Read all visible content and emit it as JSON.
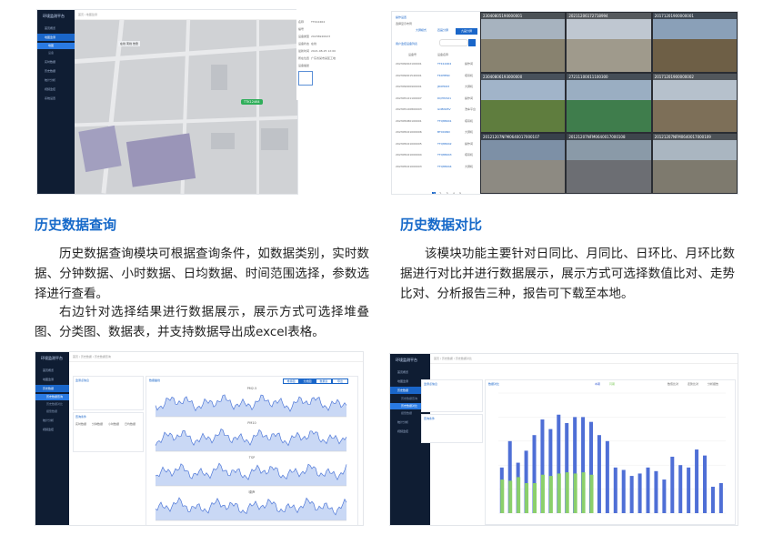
{
  "sections": {
    "history_query": {
      "title": "历史数据查询",
      "paragraph1": "历史数据查询模块可根据查询条件，如数据类别，实时数据、分钟数据、小时数据、日均数据、时间范围选择，参数选择进行查看。",
      "paragraph2": "右边针对选择结果进行数据展示，展示方式可选择堆叠图、分类图、数据表，并支持数据导出成excel表格。"
    },
    "history_compare": {
      "title": "历史数据对比",
      "paragraph1": "该模块功能主要针对日同比、月同比、日环比、月环比数据进行对比并进行数据展示，展示方式可选择数值比对、走势比对、分析报告三种，报告可下载至本地。"
    }
  },
  "shot_map": {
    "sidebar_title": "环境监测平台",
    "marker_label": "TTK12464",
    "info_rows": [
      "名称",
      "编号",
      "设备类型",
      "设备状态",
      "最新时间",
      "所在位置",
      "设备描述"
    ],
    "info_values": [
      "TTK12464",
      "",
      "20236920023",
      "在线",
      "2021-08-25 12:00",
      "广东省某市某区工地",
      ""
    ],
    "legend": [
      "在线",
      "离线",
      "告警"
    ]
  },
  "shot_video": {
    "panel_title": "操作设置",
    "tabs": [
      "大屏模式",
      "四画分屏",
      "九画分屏"
    ],
    "list_title": "用户监控设备列表",
    "col_headers": [
      "设备号",
      "设备名称"
    ],
    "rows": [
      [
        "202309002100001",
        "TTK12464",
        "操作间"
      ],
      [
        "202309001540001",
        "FK0HE60",
        "塔吊机"
      ],
      [
        "202309000900001",
        "JD0HK63",
        "大屏机"
      ],
      [
        "202305121100007",
        "DQHS5O1",
        "操作间"
      ],
      [
        "202305120800003",
        "GCBN45V",
        "洗车平台"
      ],
      [
        "202305080100001",
        "TTQ88941",
        "塔吊机"
      ],
      [
        "202305021000006",
        "BT0006D",
        "大屏机"
      ],
      [
        "202305021000005",
        "TTQ88942",
        "操作间"
      ],
      [
        "202305021000004",
        "TTQ88943",
        "塔吊机"
      ],
      [
        "202305021000003",
        "TTQ88944",
        "大屏机"
      ]
    ],
    "pagination": [
      "1",
      "2",
      "3",
      "4",
      "5",
      "..."
    ],
    "cameras": [
      "23040805190000001",
      "20211206172718994",
      "20171201900000001",
      "23040806193000000",
      "27211100011100300",
      "20171201900000002",
      "20121207NFM0640017000107",
      "20121207NFM0640017000108",
      "20121207NFM0640017000109"
    ]
  },
  "shot_query": {
    "sidebar_title": "环境监测平台",
    "info_title": "监测点信息",
    "query_title": "查询条件",
    "chart_title": "数据曲线",
    "data_types": [
      "实时数据",
      "分钟数据",
      "小时数据",
      "日均数据"
    ],
    "buttons": [
      "堆叠图",
      "分类图",
      "数据表",
      "导出"
    ],
    "series_labels": [
      "PM2.5",
      "PM10",
      "TSP",
      "噪声"
    ]
  },
  "shot_compare": {
    "info_title": "监测点信息",
    "query_title": "查询条件",
    "chart_title": "数据对比",
    "legend": [
      "本期",
      "同期"
    ],
    "modes": [
      "数值比对",
      "走势比对",
      "分析报告"
    ],
    "chart_data": {
      "type": "bar",
      "series": [
        {
          "name": "本期",
          "color": "#4f6fd6",
          "values": [
            0.38,
            0.6,
            0.42,
            0.52,
            0.65,
            0.78,
            0.7,
            0.82,
            0.75,
            0.8,
            0.8,
            0.76,
            0.65,
            0.6,
            0.38,
            0.36,
            0.31,
            0.33,
            0.38,
            0.35,
            0.28,
            0.47,
            0.4,
            0.38,
            0.53,
            0.48,
            0.22,
            0.25
          ]
        },
        {
          "name": "同期",
          "color": "#8bd06b",
          "values": [
            0.28,
            0.27,
            0.3,
            0.25,
            0.25,
            0.32,
            0.31,
            0.33,
            0.34,
            0.33,
            0.34,
            0.32,
            0.0,
            0.0,
            0.0,
            0.0,
            0.0,
            0.0,
            0.0,
            0.0,
            0.0,
            0.0,
            0.0,
            0.0,
            0.0,
            0.0,
            0.0,
            0.0
          ]
        }
      ]
    }
  }
}
